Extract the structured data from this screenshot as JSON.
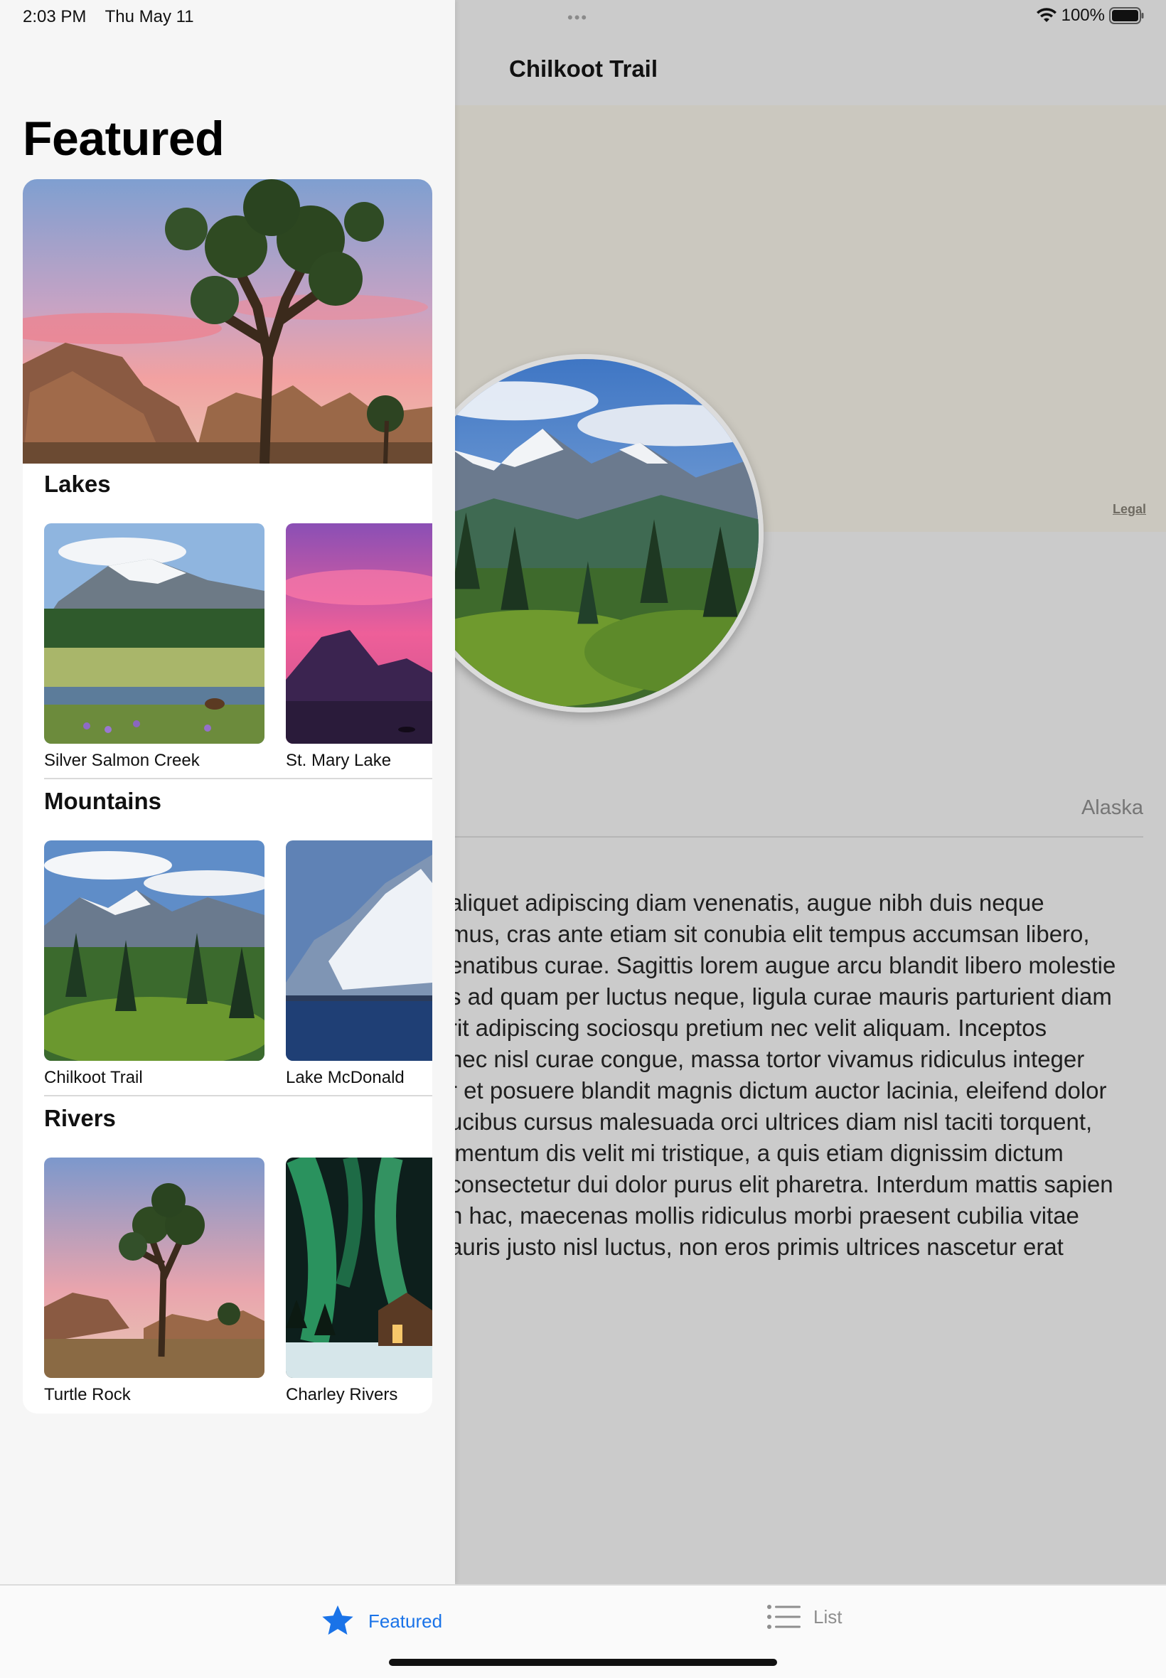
{
  "status_bar": {
    "time": "2:03 PM",
    "date": "Thu May 11",
    "battery": "100%",
    "multitask": "•••",
    "wifi_icon": "wifi-icon",
    "battery_icon": "battery-full-icon"
  },
  "detail": {
    "title": "Chilkoot Trail",
    "legal": "Legal",
    "state": "Alaska",
    "body_lines": [
      "aliquet adipiscing diam venenatis, augue nibh duis neque",
      "mus, cras ante etiam sit conubia elit tempus accumsan libero,",
      "enatibus curae. Sagittis lorem augue arcu blandit libero molestie",
      "s ad quam per luctus neque, ligula curae mauris parturient diam",
      "rit adipiscing sociosqu pretium nec velit aliquam. Inceptos",
      "nec nisl curae congue, massa tortor vivamus ridiculus integer",
      "r et posuere blandit magnis dictum auctor lacinia, eleifend dolor",
      "ucibus cursus malesuada orci ultrices diam nisl taciti torquent,",
      "imentum dis velit mi tristique, a quis etiam dignissim dictum",
      "consectetur dui dolor purus elit pharetra. Interdum mattis sapien",
      "n hac, maecenas mollis ridiculus morbi praesent cubilia vitae",
      "auris justo nisl luctus, non eros primis ultrices nascetur erat"
    ]
  },
  "sidebar": {
    "title": "Featured",
    "sections": [
      {
        "title": "Lakes",
        "items": [
          {
            "label": "Silver Salmon Creek"
          },
          {
            "label": "St. Mary Lake"
          }
        ]
      },
      {
        "title": "Mountains",
        "items": [
          {
            "label": "Chilkoot Trail"
          },
          {
            "label": "Lake McDonald"
          }
        ]
      },
      {
        "title": "Rivers",
        "items": [
          {
            "label": "Turtle Rock"
          },
          {
            "label": "Charley Rivers"
          }
        ]
      }
    ]
  },
  "tabbar": {
    "featured": {
      "label": "Featured",
      "icon": "star-icon",
      "color": "#1a73e8"
    },
    "list": {
      "label": "List",
      "icon": "list-icon",
      "color": "#8e8e8e"
    }
  }
}
